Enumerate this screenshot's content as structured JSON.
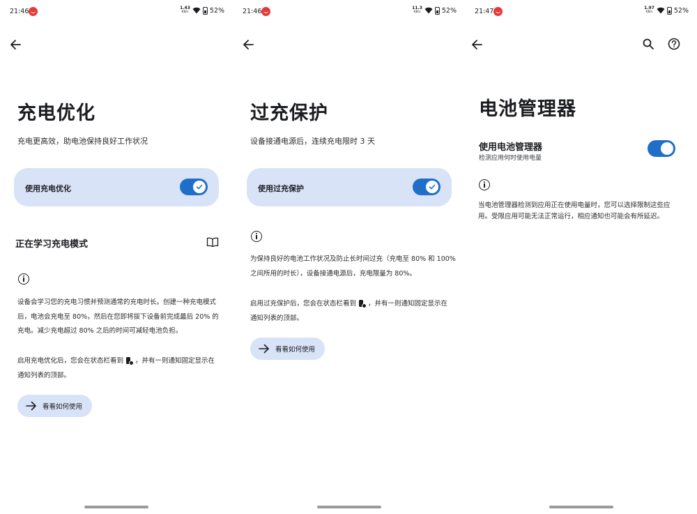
{
  "screens": [
    {
      "status": {
        "time": "21:46",
        "speed": "1.43",
        "speed_unit": "KB/s",
        "battery": "52%"
      },
      "title": "充电优化",
      "subtitle": "充电更高效，助电池保持良好工作状况",
      "toggle_card": {
        "label": "使用充电优化",
        "checked": true
      },
      "section_heading": "正在学习充电模式",
      "info_para_lines": [
        "设备会学习您的充电习惯并预测通常的充电时长。创建一种充电模式",
        "后，电池会充电至 80%，然后在您即将拔下设备前完成最后 20% 的",
        "充电。减少充电超过 80% 之后的时间可减轻电池负担。"
      ],
      "status_para": {
        "before_icon": "启用充电优化后，您会在状态栏看到",
        "after_icon": "，并有一则通知固定显示在",
        "line2": "通知列表的顶部。"
      },
      "pill_button": "看看如何使用"
    },
    {
      "status": {
        "time": "21:46",
        "speed": "11.3",
        "speed_unit": "KB/s",
        "battery": "52%"
      },
      "title": "过充保护",
      "subtitle": "设备接通电源后，连续充电限时 3 天",
      "toggle_card": {
        "label": "使用过充保护",
        "checked": true
      },
      "info_para_lines": [
        "为保持良好的电池工作状况及防止长时间过充（充电至 80% 和 100%",
        "之间所用的时长），设备接通电源后，充电限量为 80%。"
      ],
      "status_para": {
        "before_icon": "启用过充保护后，您会在状态栏看到",
        "after_icon": "，并有一则通知固定显示在",
        "line2": "通知列表的顶部。"
      },
      "pill_button": "看看如何使用"
    },
    {
      "status": {
        "time": "21:47",
        "speed": "1.97",
        "speed_unit": "KB/s",
        "battery": "52%"
      },
      "title": "电池管理器",
      "setting": {
        "label": "使用电池管理器",
        "desc": "检测应用何时使用电量",
        "checked": true
      },
      "info_para_lines": [
        "当电池管理器检测到应用正在使用电量时，您可以选择限制这些应",
        "用。受限应用可能无法正常运行，相应通知也可能会有所延迟。"
      ]
    }
  ],
  "icons": {
    "back": "arrow-left-icon",
    "search": "search-icon",
    "help": "help-icon",
    "book": "book-icon",
    "info": "info-icon",
    "arrow_right": "arrow-right-icon",
    "check": "check-icon",
    "charging_status": "battery-charging-icon"
  },
  "colors": {
    "accent": "#1f6fc9",
    "card_bg": "#d8e3f8",
    "status_dot": "#e5393b"
  }
}
